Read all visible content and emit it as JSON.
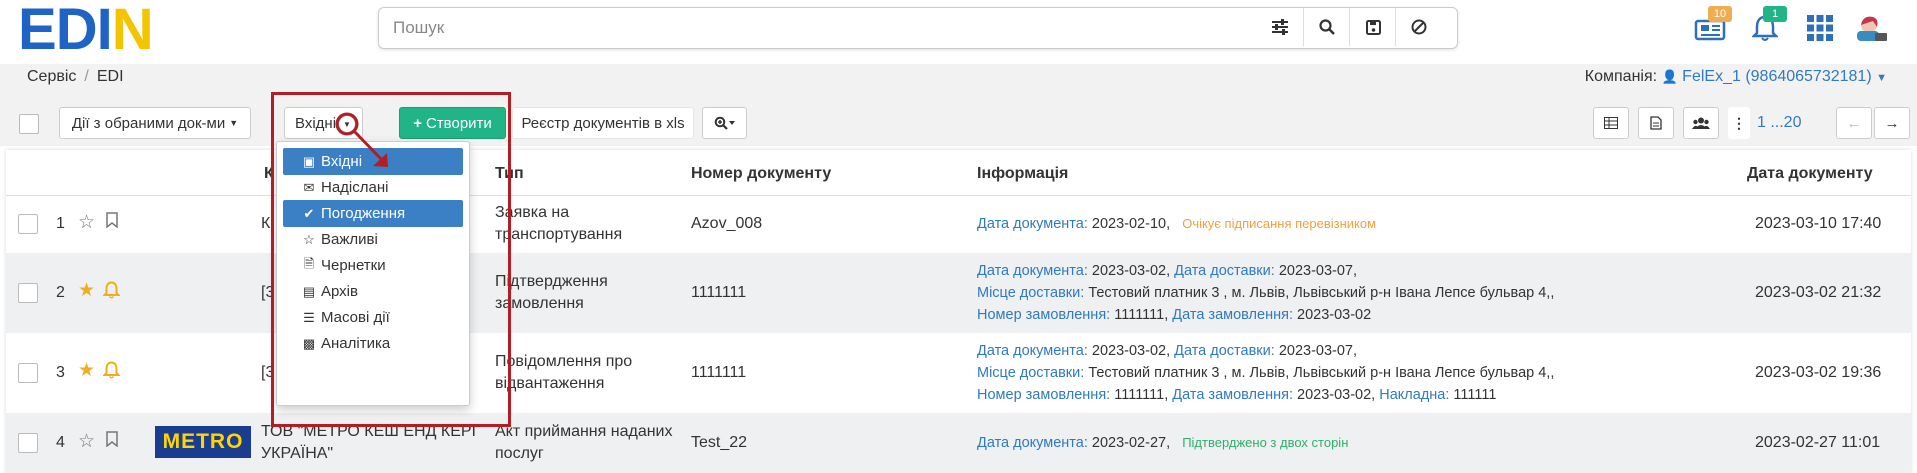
{
  "logo": {
    "e": "E",
    "d": "D",
    "n": "N",
    "i": "I"
  },
  "search": {
    "placeholder": "Пошук"
  },
  "notifications": {
    "docs_count": "10",
    "bell_count": "1"
  },
  "breadcrumb": {
    "item1": "Сервіс",
    "item2": "EDI"
  },
  "company": {
    "label": "Компанія:",
    "value": "FelEx_1 (9864065732181)"
  },
  "toolbar": {
    "actions_label": "Дії з обраними док-ми",
    "incoming_label": "Вхідні",
    "create_label": "Створити",
    "registry_label": "Реєстр документів в xls",
    "pager": "1 ...20"
  },
  "dropdown": {
    "items": [
      {
        "label": "Вхідні",
        "icon": "inbox-icon"
      },
      {
        "label": "Надіслані",
        "icon": "envelope-icon"
      },
      {
        "label": "Погодження",
        "icon": "check-icon"
      },
      {
        "label": "Важливі",
        "icon": "star-icon"
      },
      {
        "label": "Чернетки",
        "icon": "file-icon"
      },
      {
        "label": "Архів",
        "icon": "archive-icon"
      },
      {
        "label": "Масові дії",
        "icon": "list-icon"
      },
      {
        "label": "Аналітика",
        "icon": "chart-icon"
      }
    ]
  },
  "table": {
    "headers": {
      "counterparty": "К",
      "type": "Тип",
      "number": "Номер документу",
      "info": "Інформація",
      "date": "Дата документу"
    },
    "rows": [
      {
        "index": "1",
        "counterparty": "Кі",
        "type1": "Заявка на",
        "type2": "транспортування",
        "number": "Azov_008",
        "date": "2023-03-10 17:40",
        "info": {
          "l1_label": "Дата документа:",
          "l1_value": "2023-02-10,",
          "status": "Очікує підписання перевізником"
        }
      },
      {
        "index": "2",
        "counterparty": "[3",
        "type1": "Підтвердження",
        "type2": "замовлення",
        "number": "1111111",
        "date": "2023-03-02 21:32",
        "info": {
          "l1_label": "Дата документа:",
          "l1_value": "2023-03-02,",
          "l1_label2": "Дата доставки:",
          "l1_value2": "2023-03-07,",
          "l2_label": "Місце доставки:",
          "l2_value": "Тестовий платник 3 , м. Львів, Львівський р-н Івана Лепсе бульвар 4,,",
          "l3_label": "Номер замовлення:",
          "l3_value": "1111111,",
          "l3_label2": "Дата замовлення:",
          "l3_value2": "2023-03-02"
        }
      },
      {
        "index": "3",
        "counterparty": "[3",
        "type1": "Повідомлення про",
        "type2": "відвантаження",
        "number": "1111111",
        "date": "2023-03-02 19:36",
        "info": {
          "l1_label": "Дата документа:",
          "l1_value": "2023-03-02,",
          "l1_label2": "Дата доставки:",
          "l1_value2": "2023-03-07,",
          "l2_label": "Місце доставки:",
          "l2_value": "Тестовий платник 3 , м. Львів, Львівський р-н Івана Лепсе бульвар 4,,",
          "l3_label": "Номер замовлення:",
          "l3_value": "1111111,",
          "l3_label2": "Дата замовлення:",
          "l3_value2": "2023-03-02,",
          "l3_label3": "Накладна:",
          "l3_value3": "111111"
        }
      },
      {
        "index": "4",
        "logo": "METRO",
        "counterparty1": "ТОВ \"МЕТРО КЕШ ЕНД КЕРІ",
        "counterparty2": "УКРАЇНА\"",
        "type1": "Акт приймання наданих",
        "type2": "послуг",
        "number": "Test_22",
        "date": "2023-02-27 11:01",
        "info": {
          "l1_label": "Дата документа:",
          "l1_value": "2023-02-27,",
          "status": "Підтверджено з двох сторін"
        }
      }
    ]
  },
  "colors": {
    "brand_blue": "#1f64c4",
    "brand_yellow": "#f5c400",
    "green": "#20b486",
    "link": "#2f7ac2",
    "highlight_red": "#b51d24"
  }
}
